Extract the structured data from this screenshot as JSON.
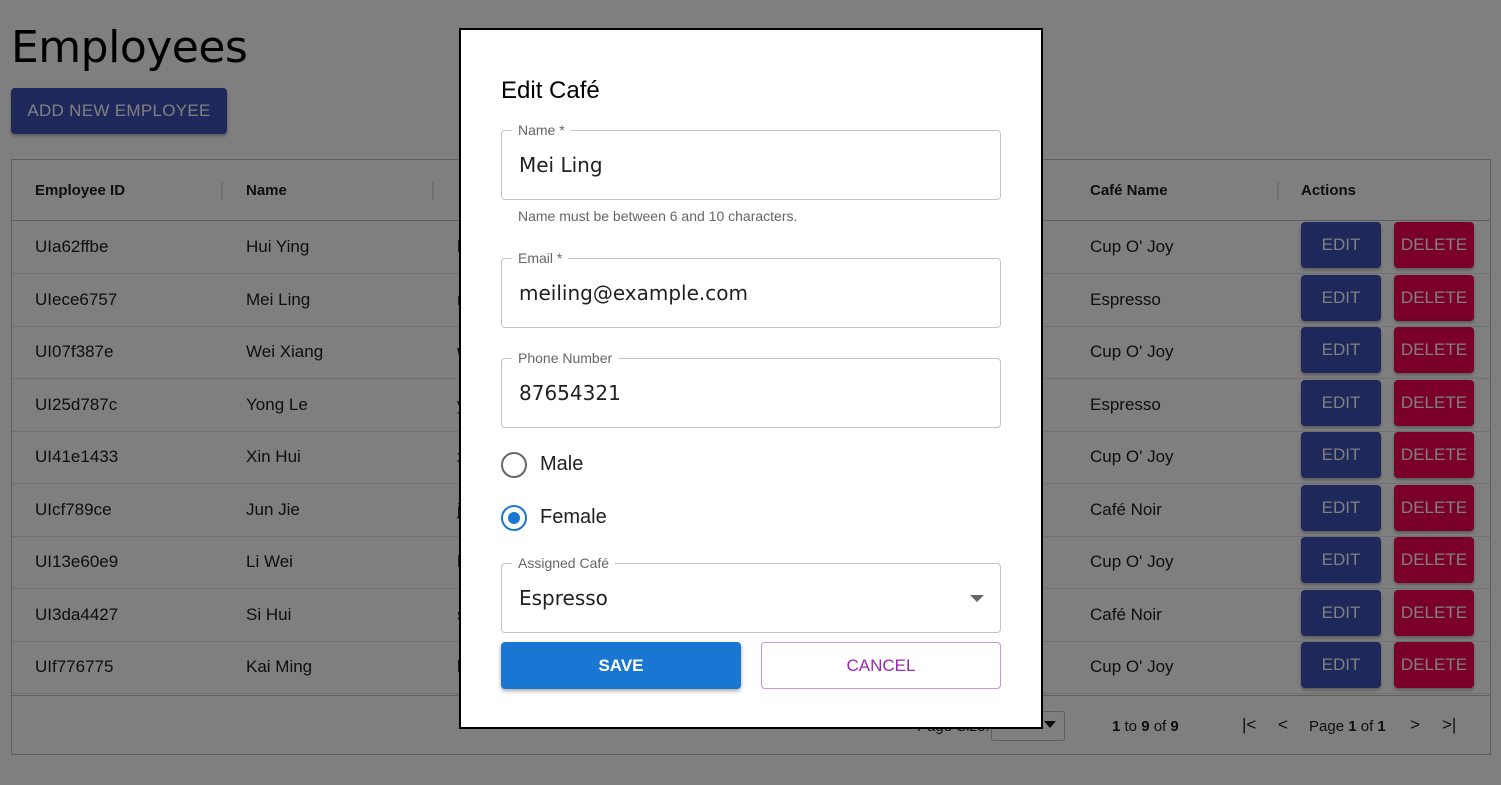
{
  "page": {
    "title": "Employees",
    "add_button": "ADD NEW EMPLOYEE"
  },
  "grid": {
    "columns": [
      "Employee ID",
      "Name",
      "Café Name",
      "Actions"
    ],
    "rows": [
      {
        "id": "UIa62ffbe",
        "name": "Hui Ying",
        "email_initial": "h",
        "cafe": "Cup O' Joy"
      },
      {
        "id": "UIece6757",
        "name": "Mei Ling",
        "email_initial": "m",
        "cafe": "Espresso"
      },
      {
        "id": "UI07f387e",
        "name": "Wei Xiang",
        "email_initial": "w",
        "cafe": "Cup O' Joy"
      },
      {
        "id": "UI25d787c",
        "name": "Yong Le",
        "email_initial": "y",
        "cafe": "Espresso"
      },
      {
        "id": "UI41e1433",
        "name": "Xin Hui",
        "email_initial": "x",
        "cafe": "Cup O' Joy"
      },
      {
        "id": "UIcf789ce",
        "name": "Jun Jie",
        "email_initial": "j",
        "cafe": "Café Noir"
      },
      {
        "id": "UI13e60e9",
        "name": "Li Wei",
        "email_initial": "l",
        "cafe": "Cup O' Joy"
      },
      {
        "id": "UI3da4427",
        "name": "Si Hui",
        "email_initial": "s",
        "cafe": "Café Noir"
      },
      {
        "id": "UIf776775",
        "name": "Kai Ming",
        "email_initial": "k",
        "cafe": "Cup O' Joy"
      }
    ],
    "edit_label": "EDIT",
    "delete_label": "DELETE",
    "footer": {
      "page_size_label": "Page Size:",
      "range_from": "1",
      "range_to_word": "to",
      "range_to": "9",
      "of_word": "of",
      "total": "9",
      "page_word": "Page",
      "current_page": "1",
      "total_pages": "1",
      "first_icon": "|<",
      "prev_icon": "<",
      "next_icon": ">",
      "last_icon": ">|"
    }
  },
  "dialog": {
    "title": "Edit Café",
    "name_label": "Name *",
    "name_value": "Mei Ling",
    "name_helper": "Name must be between 6 and 10 characters.",
    "email_label": "Email *",
    "email_value": "meiling@example.com",
    "phone_label": "Phone Number",
    "phone_value": "87654321",
    "gender_options": [
      "Male",
      "Female"
    ],
    "gender_selected": "Female",
    "cafe_label": "Assigned Café",
    "cafe_value": "Espresso",
    "save_label": "SAVE",
    "cancel_label": "CANCEL"
  },
  "colors": {
    "primary": "#3f51b5",
    "danger": "#f50057",
    "save": "#1976d2",
    "cancel": "#9c27b0"
  }
}
